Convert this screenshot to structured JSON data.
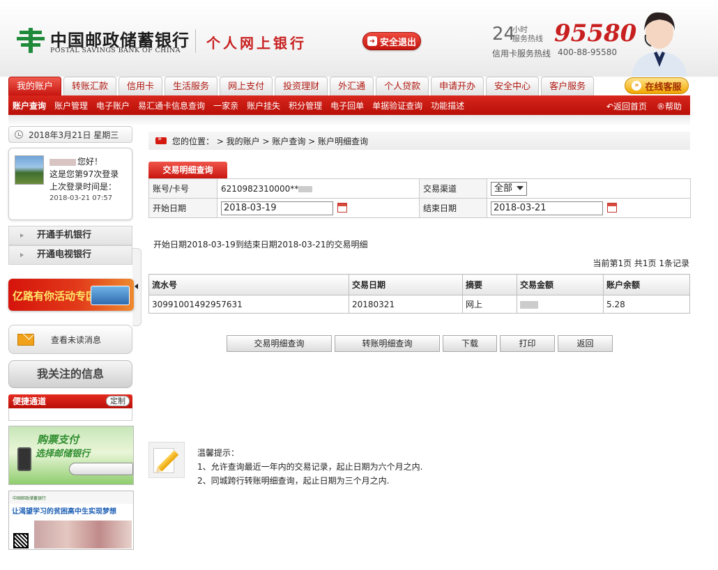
{
  "header": {
    "logo_cn": "中国邮政储蓄银行",
    "logo_en": "POSTAL SAVINGS BANK OF CHINA",
    "personal_bank": "个人网上银行",
    "logout_label": "安全退出",
    "hotline_24": "24",
    "hotline_sub1": "小时",
    "hotline_sub2": "服务热线",
    "hotline_number": "95580",
    "cc_hotline_label": "信用卡服务热线",
    "cc_hotline_number": "400-88-95580"
  },
  "nav": {
    "tabs": [
      "我的账户",
      "转账汇款",
      "信用卡",
      "生活服务",
      "网上支付",
      "投资理财",
      "外汇通",
      "个人贷款",
      "申请开办",
      "安全中心",
      "客户服务"
    ],
    "online_service": "在线客服"
  },
  "subnav": {
    "items": [
      "账户查询",
      "账户管理",
      "电子账户",
      "易汇通卡信息查询",
      "一家亲",
      "账户挂失",
      "积分管理",
      "电子回单",
      "单据验证查询",
      "功能描述"
    ],
    "home_back": "返回首页",
    "help": "帮助"
  },
  "sidebar": {
    "date": "2018年3月21日 星期三",
    "greeting": "您好！",
    "login_count": "这是您第97次登录",
    "last_login_label": "上次登录时间是：",
    "last_login_time": "2018-03-21 07:57",
    "open_mobile": "开通手机银行",
    "open_tv": "开通电视银行",
    "promo_text": "亿路有你活动专区",
    "unread_messages": "查看未读消息",
    "my_focus": "我关注的信息",
    "quick_channel": "便捷通道",
    "customize": "定制",
    "ad1_line1": "购票支付",
    "ad1_line2": "选择邮储银行",
    "ad2_header": "中国邮政储蓄银行",
    "ad2_title": "让渴望学习的贫困高中生实现梦想"
  },
  "main": {
    "breadcrumb": "您的位置：  >  我的账户 >  账户查询 >  账户明细查询",
    "query_tab": "交易明细查询",
    "form": {
      "account_label": "账号/卡号",
      "account_value": "6210982310000**",
      "channel_label": "交易渠道",
      "channel_value": "全部",
      "start_label": "开始日期",
      "start_value": "2018-03-19",
      "end_label": "结束日期",
      "end_value": "2018-03-21"
    },
    "range_text": "开始日期2018-03-19到结束日期2018-03-21的交易明细",
    "page_info": "当前第1页 共1页 1条记录",
    "table": {
      "headers": [
        "流水号",
        "交易日期",
        "摘要",
        "交易金额",
        "账户余额"
      ],
      "rows": [
        {
          "serial": "30991001492957631",
          "date": "20180321",
          "summary": "网上",
          "amount": "",
          "balance": "5.28"
        }
      ]
    },
    "buttons": [
      "交易明细查询",
      "转账明细查询",
      "下载",
      "打印",
      "返回"
    ],
    "tips": {
      "title": "温馨提示：",
      "line1": "1、允许查询最近一年内的交易记录，起止日期为六个月之内.",
      "line2": "2、同城跨行转账明细查询，起止日期为三个月之内."
    }
  }
}
